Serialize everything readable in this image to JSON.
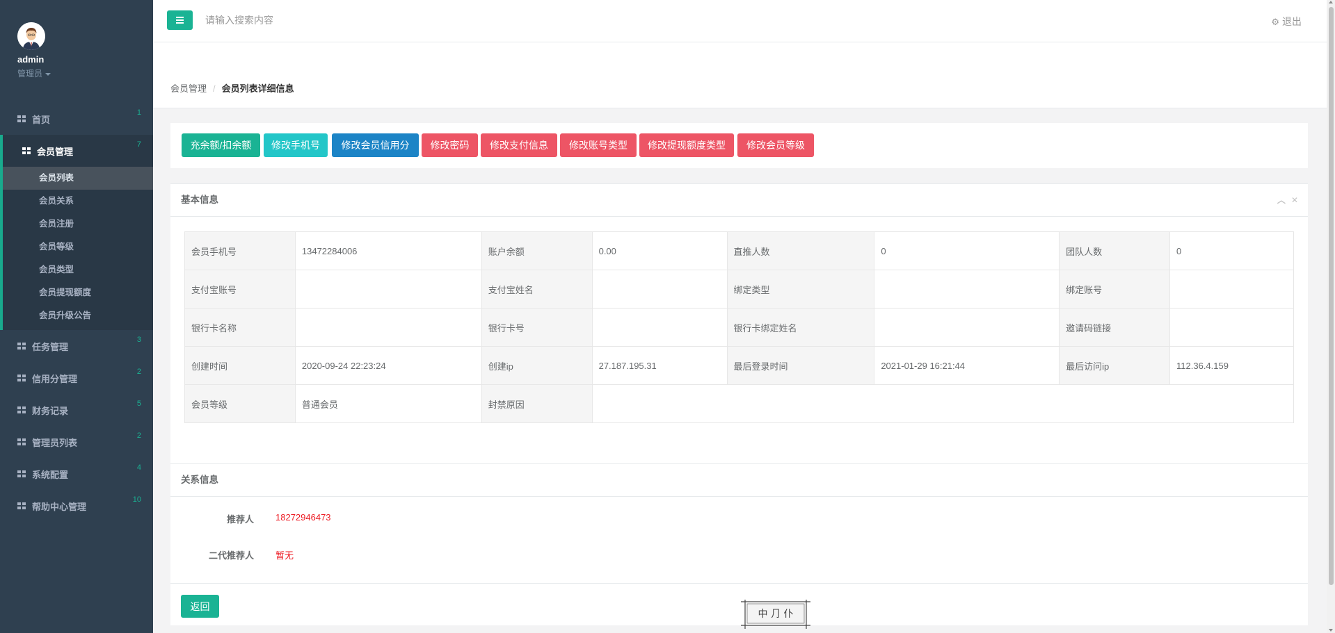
{
  "profile": {
    "name": "admin",
    "role": "管理员"
  },
  "nav": [
    {
      "label": "首页",
      "badge": "1"
    },
    {
      "label": "会员管理",
      "badge": "7"
    },
    {
      "label": "任务管理",
      "badge": "3"
    },
    {
      "label": "信用分管理",
      "badge": "2"
    },
    {
      "label": "财务记录",
      "badge": "5"
    },
    {
      "label": "管理员列表",
      "badge": "2"
    },
    {
      "label": "系统配置",
      "badge": "4"
    },
    {
      "label": "帮助中心管理",
      "badge": "10"
    }
  ],
  "subnav": [
    "会员列表",
    "会员关系",
    "会员注册",
    "会员等级",
    "会员类型",
    "会员提现额度",
    "会员升级公告"
  ],
  "topbar": {
    "search_placeholder": "请输入搜索内容",
    "logout": "退出"
  },
  "breadcrumb": {
    "parent": "会员管理",
    "current": "会员列表详细信息"
  },
  "actions": [
    {
      "label": "充余额/扣余额",
      "color": "#1ab394"
    },
    {
      "label": "修改手机号",
      "color": "#23c6c8"
    },
    {
      "label": "修改会员信用分",
      "color": "#1c84c6"
    },
    {
      "label": "修改密码",
      "color": "#ed5565"
    },
    {
      "label": "修改支付信息",
      "color": "#ed5565"
    },
    {
      "label": "修改账号类型",
      "color": "#ed5565"
    },
    {
      "label": "修改提现额度类型",
      "color": "#ed5565"
    },
    {
      "label": "修改会员等级",
      "color": "#ed5565"
    }
  ],
  "basic_info": {
    "title": "基本信息",
    "rows": [
      [
        {
          "label": "会员手机号",
          "value": "13472284006"
        },
        {
          "label": "账户余额",
          "value": "0.00"
        },
        {
          "label": "直推人数",
          "value": "0"
        },
        {
          "label": "团队人数",
          "value": "0"
        }
      ],
      [
        {
          "label": "支付宝账号",
          "value": ""
        },
        {
          "label": "支付宝姓名",
          "value": ""
        },
        {
          "label": "绑定类型",
          "value": ""
        },
        {
          "label": "绑定账号",
          "value": ""
        }
      ],
      [
        {
          "label": "银行卡名称",
          "value": ""
        },
        {
          "label": "银行卡号",
          "value": ""
        },
        {
          "label": "银行卡绑定姓名",
          "value": ""
        },
        {
          "label": "邀请码链接",
          "value": ""
        }
      ],
      [
        {
          "label": "创建时间",
          "value": "2020-09-24 22:23:24"
        },
        {
          "label": "创建ip",
          "value": "27.187.195.31"
        },
        {
          "label": "最后登录时间",
          "value": "2021-01-29 16:21:44"
        },
        {
          "label": "最后访问ip",
          "value": "112.36.4.159"
        }
      ]
    ],
    "last_row": [
      {
        "label": "会员等级",
        "value": "普通会员"
      },
      {
        "label": "封禁原因",
        "value": ""
      }
    ]
  },
  "relation_info": {
    "title": "关系信息",
    "referrer_label": "推荐人",
    "referrer_value": "18272946473",
    "second_referrer_label": "二代推荐人",
    "second_referrer_value": "暂无"
  },
  "back_button": "返回",
  "stamp_text": "中 ⺆ 仆"
}
